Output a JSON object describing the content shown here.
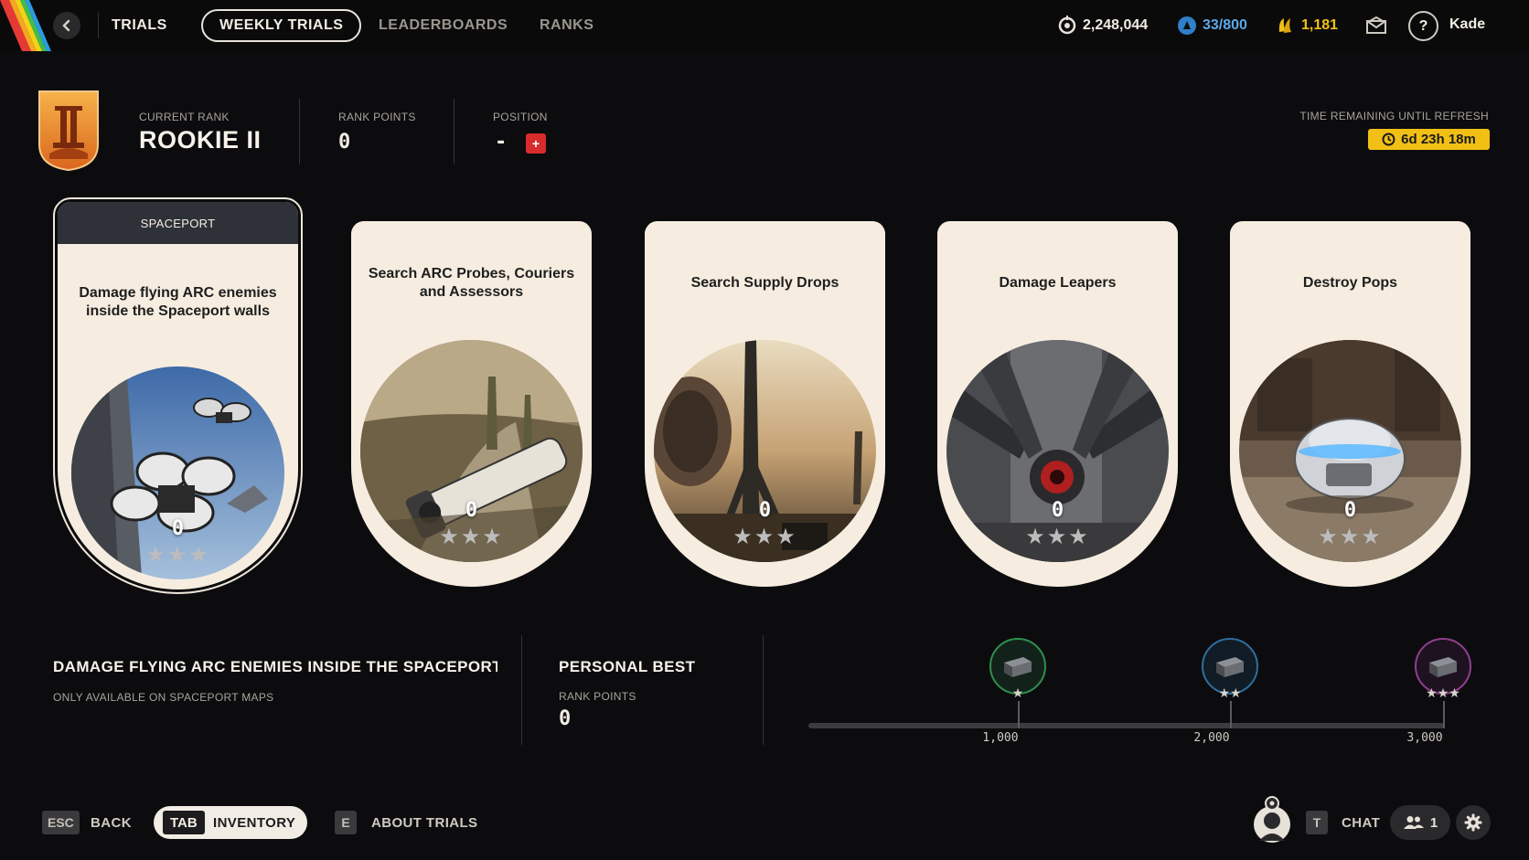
{
  "nav": {
    "main": "TRIALS",
    "tabs": [
      {
        "label": "WEEKLY TRIALS",
        "active": true
      },
      {
        "label": "LEADERBOARDS",
        "active": false
      },
      {
        "label": "RANKS",
        "active": false
      }
    ]
  },
  "currencies": {
    "credits": "2,248,044",
    "tokens": "33/800",
    "coins": "1,181"
  },
  "user": {
    "name": "Kade"
  },
  "rank": {
    "current_rank_label": "CURRENT RANK",
    "current_rank": "ROOKIE II",
    "rank_points_label": "RANK POINTS",
    "rank_points": "0",
    "position_label": "POSITION",
    "position": "-",
    "position_badge": "+"
  },
  "timer": {
    "label": "TIME REMAINING UNTIL REFRESH",
    "value": "6d 23h 18m"
  },
  "trials": [
    {
      "tag": "SPACEPORT",
      "title": "Damage flying ARC enemies inside the Spaceport walls",
      "score": "0",
      "stars": "★★★",
      "image": "flying-drones",
      "selected": true
    },
    {
      "tag": "",
      "title": "Search ARC Probes, Couriers and Assessors",
      "score": "0",
      "stars": "★★★",
      "image": "arc-probe",
      "selected": false
    },
    {
      "tag": "",
      "title": "Search Supply Drops",
      "score": "0",
      "stars": "★★★",
      "image": "supply-drop",
      "selected": false
    },
    {
      "tag": "",
      "title": "Damage Leapers",
      "score": "0",
      "stars": "★★★",
      "image": "leaper",
      "selected": false
    },
    {
      "tag": "",
      "title": "Destroy Pops",
      "score": "0",
      "stars": "★★★",
      "image": "pop",
      "selected": false
    }
  ],
  "details": {
    "title": "DAMAGE FLYING ARC ENEMIES INSIDE THE SPACEPORT WALLS",
    "subtitle": "ONLY AVAILABLE ON SPACEPORT MAPS",
    "personal_best_title": "PERSONAL BEST",
    "personal_best_label": "RANK POINTS",
    "personal_best_value": "0"
  },
  "milestones": [
    {
      "stars": "★",
      "value": "1,000",
      "color": "#2f8f4e",
      "progress": 0
    },
    {
      "stars": "★★",
      "value": "2,000",
      "color": "#2f6f9f",
      "progress": 0
    },
    {
      "stars": "★★★",
      "value": "3,000",
      "color": "#8f3f8f",
      "progress": 0
    }
  ],
  "bottom": {
    "back_key": "ESC",
    "back_label": "BACK",
    "inventory_key": "TAB",
    "inventory_label": "INVENTORY",
    "about_key": "E",
    "about_label": "ABOUT TRIALS",
    "chat_key": "T",
    "chat_label": "CHAT",
    "party_count": "1"
  },
  "colors": {
    "accent_yellow": "#f2c015",
    "card_bg": "#f6ede0",
    "position_badge": "#d82b2b"
  }
}
